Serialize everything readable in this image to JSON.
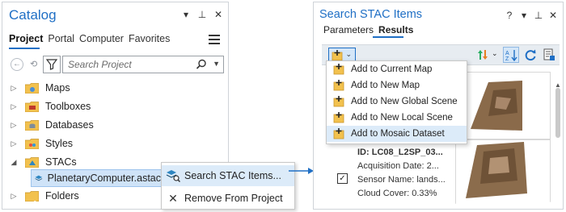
{
  "catalog": {
    "title": "Catalog",
    "window_controls": [
      "▾",
      "⊥",
      "✕"
    ],
    "tabs": [
      {
        "label": "Project",
        "active": true
      },
      {
        "label": "Portal",
        "active": false
      },
      {
        "label": "Computer",
        "active": false
      },
      {
        "label": "Favorites",
        "active": false
      }
    ],
    "search_placeholder": "Search Project",
    "tree": [
      {
        "label": "Maps",
        "expanded": false,
        "icon": "maps-folder-icon"
      },
      {
        "label": "Toolboxes",
        "expanded": false,
        "icon": "toolboxes-folder-icon"
      },
      {
        "label": "Databases",
        "expanded": false,
        "icon": "databases-folder-icon"
      },
      {
        "label": "Styles",
        "expanded": false,
        "icon": "styles-folder-icon"
      },
      {
        "label": "STACs",
        "expanded": true,
        "icon": "stacs-folder-icon"
      },
      {
        "label": "PlanetaryComputer.astac",
        "child": true,
        "selected": true,
        "icon": "stac-connection-icon"
      },
      {
        "label": "Folders",
        "expanded": false,
        "icon": "folders-folder-icon"
      }
    ]
  },
  "context_menu": {
    "items": [
      {
        "label": "Search STAC Items...",
        "icon": "search-stac-icon",
        "hover": true
      },
      {
        "label": "Remove From Project",
        "icon": "close-icon",
        "hover": false
      }
    ]
  },
  "stac_panel": {
    "title": "Search STAC Items",
    "window_controls": [
      "?",
      "▾",
      "⊥",
      "✕"
    ],
    "tabs": [
      {
        "label": "Parameters",
        "active": false
      },
      {
        "label": "Results",
        "active": true
      }
    ],
    "add_menu": [
      {
        "label": "Add to Current  Map",
        "hover": false
      },
      {
        "label": "Add to New Map",
        "hover": false
      },
      {
        "label": "Add to New Global Scene",
        "hover": false
      },
      {
        "label": "Add to New Local Scene",
        "hover": false
      },
      {
        "label": "Add to Mosaic Dataset",
        "hover": true
      }
    ],
    "result": {
      "id": "ID: LC08_L2SP_03...",
      "acquisition": "Acquisition Date: 2...",
      "sensor": "Sensor Name: lands...",
      "cloud": "Cloud Cover: 0.33%",
      "checked": "✓"
    }
  },
  "colors": {
    "accent": "#1f6fc5",
    "folder": "#f2c14e",
    "hover": "#dcebf9",
    "selected": "#cfe3f8"
  }
}
